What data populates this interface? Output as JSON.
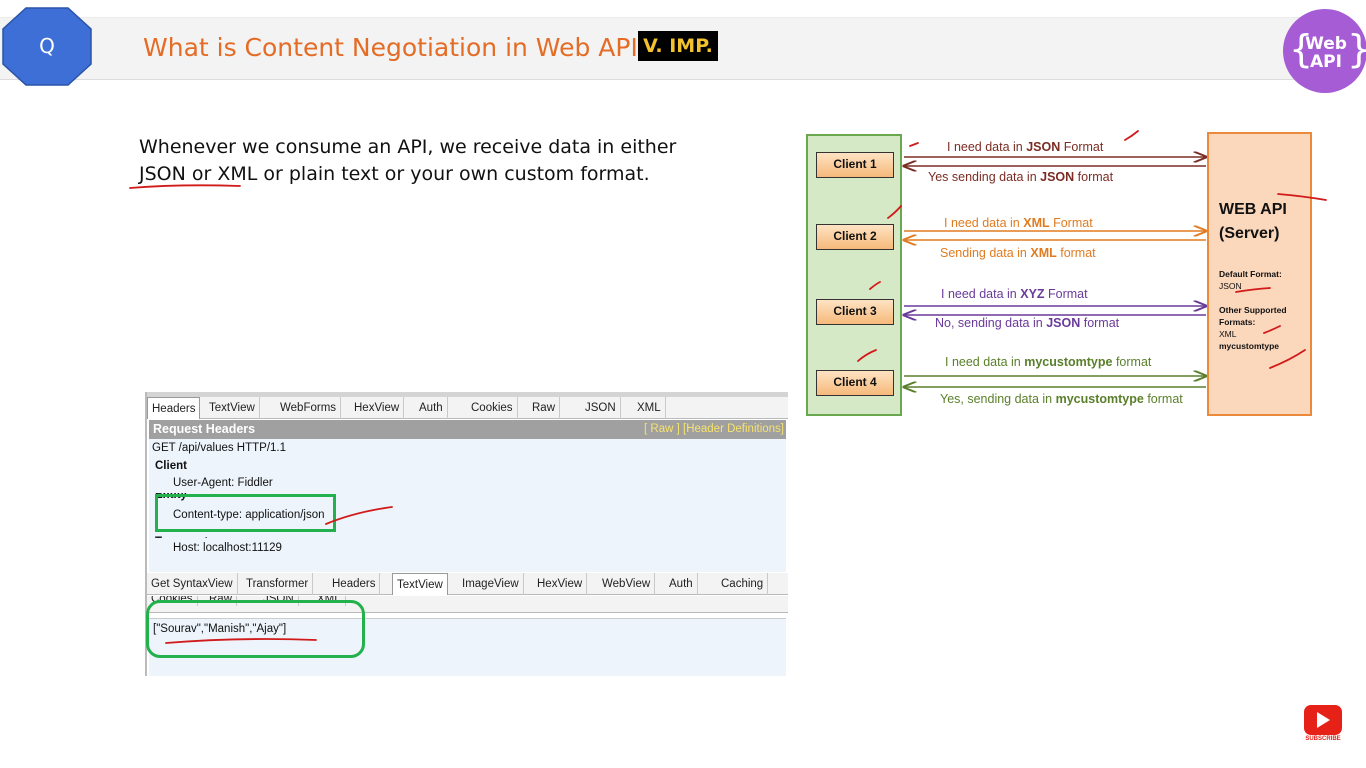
{
  "header": {
    "search_glyph": "Q",
    "title": "What is Content Negotiation in Web API?",
    "badge": "V. IMP.",
    "logo_line1": "Web",
    "logo_line2": "API",
    "logo_brace_left": "{",
    "logo_brace_right": "}"
  },
  "intro": {
    "line1": "Whenever we consume an API, we receive data in either",
    "line2": "JSON or XML or plain text or your own custom format."
  },
  "diagram": {
    "clients": [
      "Client 1",
      "Client 2",
      "Client 3",
      "Client 4"
    ],
    "server_title_1": "WEB API",
    "server_title_2": "(Server)",
    "default_format_label": "Default Format:",
    "default_format_value": "JSON",
    "other_formats_label_1": "Other Supported",
    "other_formats_label_2": "Formats:",
    "other_format_1": "XML",
    "other_format_2": "mycustomtype",
    "messages": [
      {
        "pre": "I need data in ",
        "bold": "JSON",
        "post": " Format",
        "color": "#7b2d24"
      },
      {
        "pre": "Yes sending data in ",
        "bold": "JSON",
        "post": " format",
        "color": "#7b2d24"
      },
      {
        "pre": "I need data in ",
        "bold": "XML",
        "post": " Format",
        "color": "#e07b20"
      },
      {
        "pre": "Sending data in ",
        "bold": "XML",
        "post": " format",
        "color": "#e07b20"
      },
      {
        "pre": "I need data in ",
        "bold": "XYZ",
        "post": " Format",
        "color": "#6a3a9a"
      },
      {
        "pre": "No, sending data in ",
        "bold": "JSON",
        "post": " format",
        "color": "#6a3a9a"
      },
      {
        "pre": "I need data in ",
        "bold": "mycustomtype",
        "post": " format",
        "color": "#5a7f2a"
      },
      {
        "pre": "Yes, sending data in ",
        "bold": "mycustomtype",
        "post": " format",
        "color": "#5a7f2a"
      }
    ]
  },
  "fiddler": {
    "request_tabs": [
      "Headers",
      "TextView",
      "WebForms",
      "HexView",
      "Auth",
      "Cookies",
      "Raw",
      "JSON",
      "XML"
    ],
    "request_headers_title": "Request Headers",
    "header_links": "[ Raw ]   [Header Definitions]",
    "request_line": "GET /api/values HTTP/1.1",
    "client_group": "Client",
    "user_agent": "User-Agent: Fiddler",
    "entity_group": "Entity",
    "content_type": "Content-type: application/json",
    "transport_group": "Transport",
    "host": "Host: localhost:11129",
    "response_tabs": [
      "Get SyntaxView",
      "Transformer",
      "Headers",
      "TextView",
      "ImageView",
      "HexView",
      "WebView",
      "Auth",
      "Caching"
    ],
    "response_tabs_2": [
      "Cookies",
      "Raw",
      "JSON",
      "XML"
    ],
    "response_body": "[\"Sourav\",\"Manish\",\"Ajay\"]"
  },
  "footer": {
    "subscribe_label": "SUBSCRIBE"
  },
  "colors": {
    "title": "#e46c24",
    "badge_bg": "#000000",
    "badge_text": "#f2c12e",
    "q_badge": "#3d6fd6",
    "logo": "#a55cd4",
    "client_panel": "#d6e9c7",
    "server_panel": "#fbd7bc",
    "green_highlight": "#22b14c",
    "ink_red": "#d11a1a"
  }
}
